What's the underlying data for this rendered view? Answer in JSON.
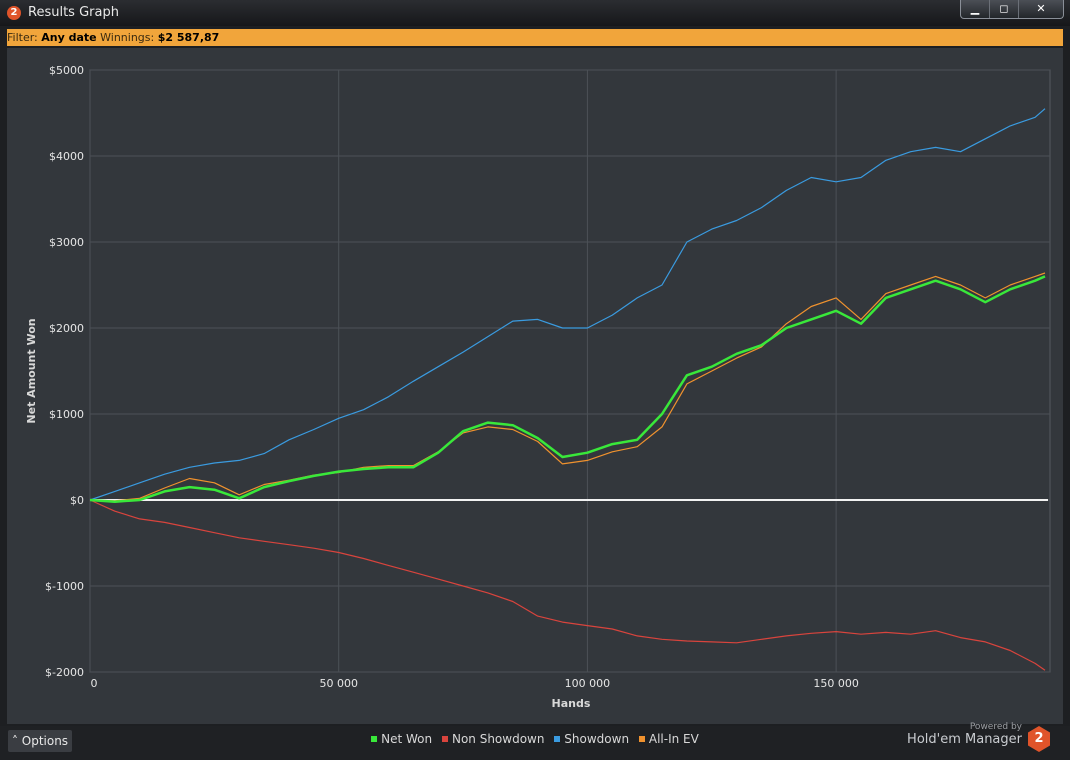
{
  "window": {
    "badge": "2",
    "title": "Results Graph",
    "controls": {
      "minimize": "▁",
      "maximize": "◻",
      "close": "✕"
    }
  },
  "filter": {
    "label": "Filter: ",
    "value": "Any date",
    "winnings_label": " Winnings: ",
    "winnings_value": "$2 587,87"
  },
  "options": {
    "label": "˄  Options"
  },
  "brand": {
    "small": "Powered by",
    "name": "Hold'em Manager",
    "logo": "2"
  },
  "colors": {
    "background": "#33373c",
    "net_won": "#39e83a",
    "non_showdown": "#d9443d",
    "showdown": "#3a9be0",
    "all_in_ev": "#f0922e"
  },
  "chart_data": {
    "type": "line",
    "title": "",
    "xlabel": "Hands",
    "ylabel": "Net Amount Won",
    "xlim": [
      0,
      193000
    ],
    "ylim": [
      -2000,
      5000
    ],
    "x_ticks": [
      0,
      50000,
      100000,
      150000
    ],
    "x_tick_labels": [
      "0",
      "50 000",
      "100 000",
      "150 000"
    ],
    "y_ticks": [
      -2000,
      -1000,
      0,
      1000,
      2000,
      3000,
      4000,
      5000
    ],
    "y_tick_labels": [
      "$-2000",
      "$-1000",
      "$0",
      "$1000",
      "$2000",
      "$3000",
      "$4000",
      "$5000"
    ],
    "grid": true,
    "legend_position": "bottom",
    "x": [
      0,
      5000,
      10000,
      15000,
      20000,
      25000,
      30000,
      35000,
      40000,
      45000,
      50000,
      55000,
      60000,
      65000,
      70000,
      75000,
      80000,
      85000,
      90000,
      95000,
      100000,
      105000,
      110000,
      115000,
      120000,
      125000,
      130000,
      135000,
      140000,
      145000,
      150000,
      155000,
      160000,
      165000,
      170000,
      175000,
      180000,
      185000,
      190000,
      192000
    ],
    "series": [
      {
        "name": "Net Won",
        "color": "#39e83a",
        "values": [
          0,
          -20,
          0,
          100,
          150,
          120,
          20,
          150,
          220,
          280,
          330,
          360,
          380,
          380,
          550,
          800,
          900,
          870,
          720,
          500,
          550,
          650,
          700,
          1000,
          1450,
          1550,
          1700,
          1800,
          2000,
          2100,
          2200,
          2050,
          2350,
          2450,
          2550,
          2450,
          2300,
          2450,
          2550,
          2600
        ]
      },
      {
        "name": "Non Showdown",
        "color": "#d9443d",
        "values": [
          0,
          -130,
          -220,
          -260,
          -320,
          -380,
          -440,
          -480,
          -520,
          -560,
          -610,
          -680,
          -760,
          -840,
          -920,
          -1000,
          -1080,
          -1180,
          -1350,
          -1420,
          -1460,
          -1500,
          -1580,
          -1620,
          -1640,
          -1650,
          -1660,
          -1620,
          -1580,
          -1550,
          -1530,
          -1560,
          -1540,
          -1560,
          -1520,
          -1600,
          -1650,
          -1750,
          -1900,
          -1980
        ]
      },
      {
        "name": "Showdown",
        "color": "#3a9be0",
        "values": [
          0,
          100,
          200,
          300,
          380,
          430,
          460,
          540,
          700,
          820,
          950,
          1050,
          1200,
          1380,
          1550,
          1720,
          1900,
          2080,
          2100,
          2000,
          2000,
          2150,
          2350,
          2500,
          3000,
          3150,
          3250,
          3400,
          3600,
          3750,
          3700,
          3750,
          3950,
          4050,
          4100,
          4050,
          4200,
          4350,
          4450,
          4550
        ]
      },
      {
        "name": "All-In EV",
        "color": "#f0922e",
        "values": [
          0,
          -10,
          20,
          140,
          250,
          200,
          60,
          180,
          230,
          290,
          320,
          380,
          400,
          400,
          560,
          780,
          850,
          820,
          680,
          420,
          460,
          560,
          620,
          850,
          1350,
          1500,
          1650,
          1780,
          2050,
          2250,
          2350,
          2100,
          2400,
          2500,
          2600,
          2500,
          2350,
          2500,
          2600,
          2640
        ]
      }
    ]
  }
}
